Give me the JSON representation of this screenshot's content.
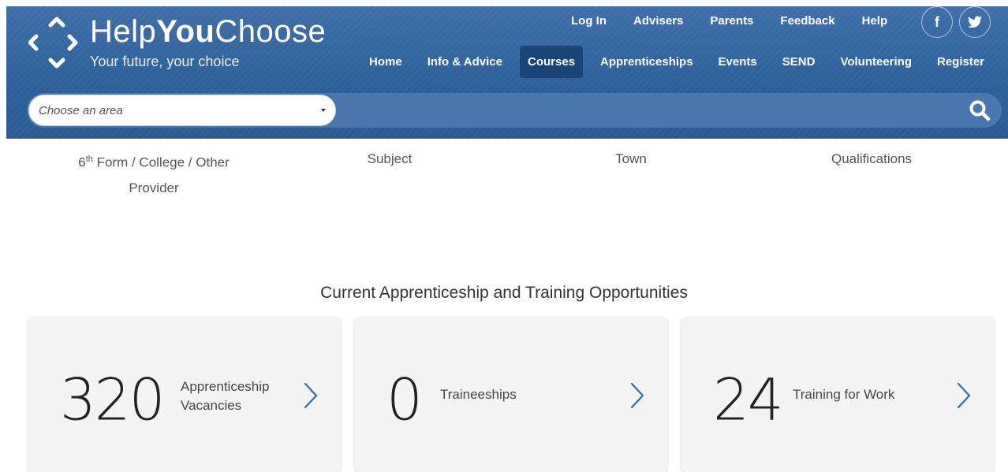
{
  "brand": {
    "name_part1": "Help",
    "name_part2": "You",
    "name_part3": "Choose",
    "tagline": "Your future, your choice"
  },
  "top_nav": [
    "Log In",
    "Advisers",
    "Parents",
    "Feedback",
    "Help"
  ],
  "social": {
    "facebook": "f",
    "twitter": "t"
  },
  "main_nav": {
    "items": [
      "Home",
      "Info & Advice",
      "Courses",
      "Apprenticeships",
      "Events",
      "SEND",
      "Volunteering",
      "Register"
    ],
    "active": "Courses"
  },
  "search": {
    "area_placeholder": "Choose an area"
  },
  "filters": {
    "provider_prefix": "6",
    "provider_sup": "th",
    "provider_rest1": " Form / College / Other",
    "provider_rest2": "Provider",
    "subject": "Subject",
    "town": "Town",
    "qualifications": "Qualifications"
  },
  "opportunities": {
    "title": "Current Apprenticeship and Training Opportunities",
    "cards": [
      {
        "count": "320",
        "label_line1": "Apprenticeship",
        "label_line2": "Vacancies"
      },
      {
        "count": "0",
        "label_line1": "Traineeships",
        "label_line2": ""
      },
      {
        "count": "24",
        "label_line1": "Training for Work",
        "label_line2": ""
      }
    ]
  },
  "colors": {
    "header": "#2d5f99",
    "active_nav": "#1c4577",
    "arrow": "#2f6db5"
  }
}
